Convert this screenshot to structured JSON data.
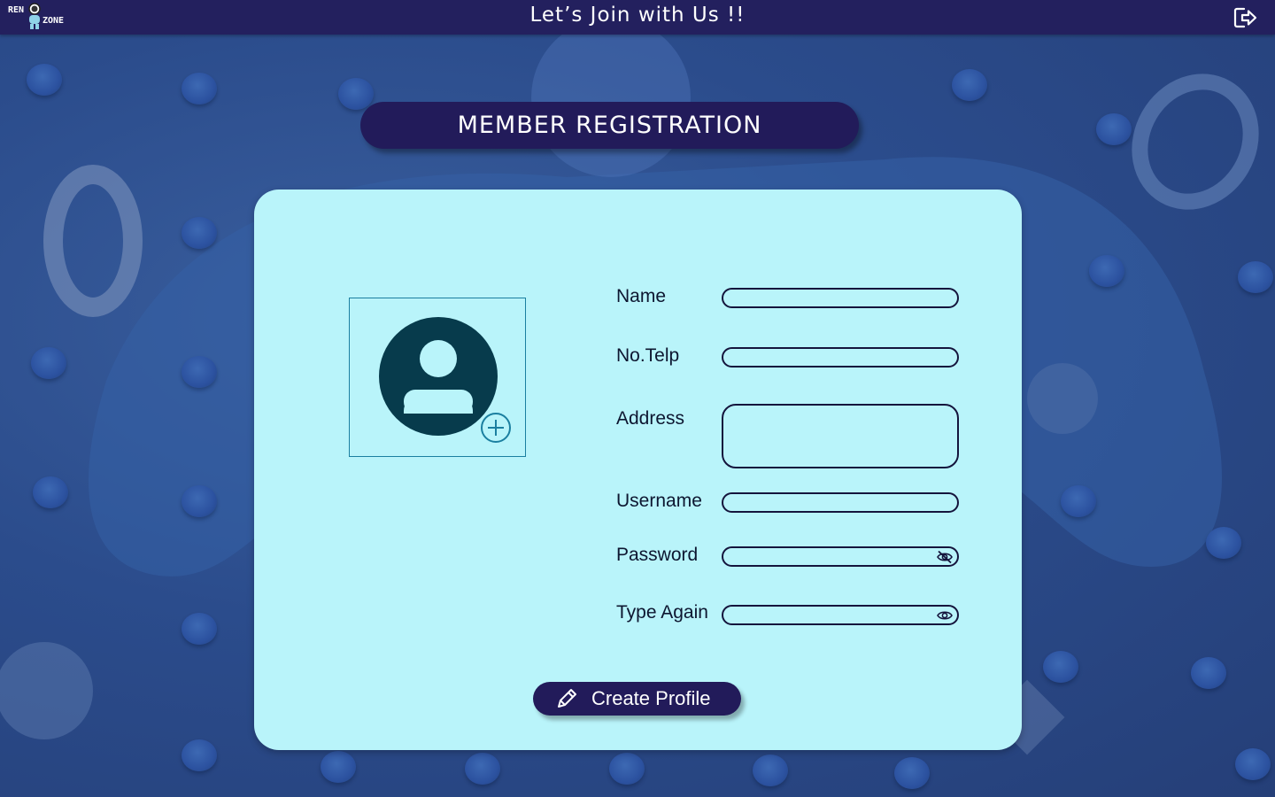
{
  "header": {
    "logo_top": "REN",
    "logo_bottom": "ZONE",
    "title": "Let’s Join with Us !!",
    "exit_icon": "logout-icon"
  },
  "banner": {
    "title": "MEMBER REGISTRATION"
  },
  "form": {
    "avatar_icon": "user-avatar-icon",
    "add_photo_icon": "plus-circle-icon",
    "fields": {
      "name": {
        "label": "Name",
        "value": ""
      },
      "phone": {
        "label": "No.Telp",
        "value": ""
      },
      "address": {
        "label": "Address",
        "value": ""
      },
      "username": {
        "label": "Username",
        "value": ""
      },
      "password": {
        "label": "Password",
        "value": "",
        "toggle_icon": "eye-slash-icon"
      },
      "confirm": {
        "label": "Type Again",
        "value": "",
        "toggle_icon": "eye-icon"
      }
    },
    "submit_label": "Create Profile",
    "submit_icon": "pencil-icon"
  },
  "colors": {
    "topbar": "#23205e",
    "banner": "#221b5a",
    "card": "#b9f4fa",
    "avatar": "#073b4c",
    "background": "#2b4c8c"
  }
}
